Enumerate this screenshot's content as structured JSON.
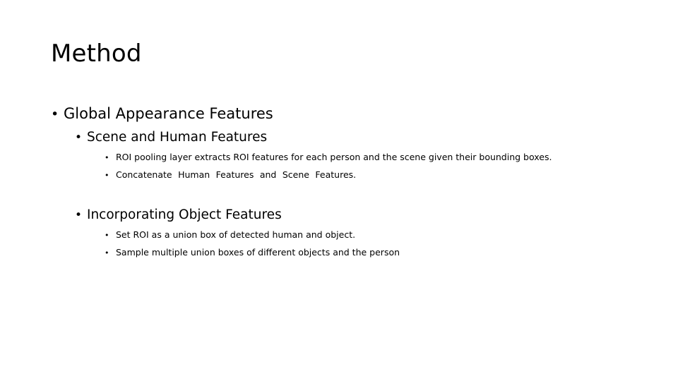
{
  "slide": {
    "title": "Method",
    "bullet_glyph": "•",
    "text_color": "#000000",
    "background_color": "#ffffff",
    "groups": [
      {
        "heading": {
          "level": 1,
          "text": "Global Appearance Features"
        },
        "subheading": {
          "level": 2,
          "text": "Scene and Human Features"
        },
        "details": [
          {
            "level": 3,
            "text": "ROI pooling layer extracts ROI features for each person and the scene given their bounding boxes.",
            "wide_spacing": false
          },
          {
            "level": 3,
            "text": "Concatenate Human Features and Scene Features.",
            "wide_spacing": true
          }
        ]
      },
      {
        "heading": null,
        "subheading": {
          "level": 2,
          "text": "Incorporating Object Features"
        },
        "details": [
          {
            "level": 3,
            "text": "Set ROI as a union box of detected human and object.",
            "wide_spacing": false
          },
          {
            "level": 3,
            "text": "Sample multiple union boxes of different objects and the person",
            "wide_spacing": false
          }
        ]
      }
    ]
  }
}
